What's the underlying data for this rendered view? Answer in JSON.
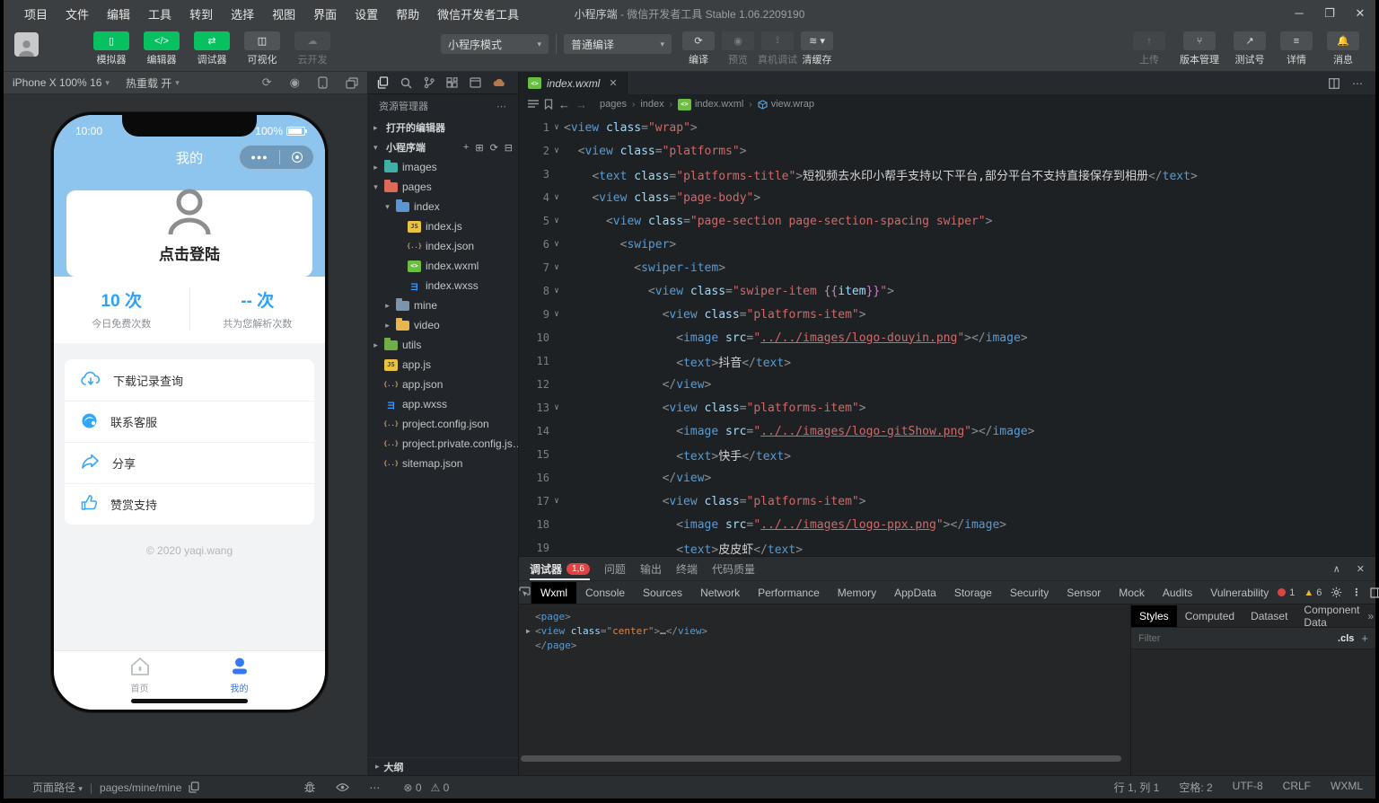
{
  "colors": {
    "accent_green": "#07c160",
    "phone_header_blue": "#8ec5ef",
    "app_blue": "#2aa2f8",
    "tab_active_blue": "#3478f6",
    "badge_red": "#e04343",
    "warn_yellow": "#e8b930"
  },
  "window": {
    "menus": [
      "项目",
      "文件",
      "编辑",
      "工具",
      "转到",
      "选择",
      "视图",
      "界面",
      "设置",
      "帮助",
      "微信开发者工具"
    ],
    "title_app": "小程序端",
    "title_rest": " - 微信开发者工具 Stable 1.06.2209190",
    "controls": {
      "minimize": "─",
      "maximize": "❐",
      "close": "✕"
    }
  },
  "toolbar": {
    "left_buttons": [
      {
        "name": "simulator-toggle",
        "label": "模拟器",
        "icon": "phone-icon",
        "state": "on"
      },
      {
        "name": "editor-toggle",
        "label": "编辑器",
        "icon": "code-icon",
        "state": "on"
      },
      {
        "name": "debugger-toggle",
        "label": "调试器",
        "icon": "swap-icon",
        "state": "on"
      },
      {
        "name": "visualizer-toggle",
        "label": "可视化",
        "icon": "layout-icon",
        "state": "off"
      },
      {
        "name": "cloud-dev",
        "label": "云开发",
        "icon": "cloud-icon",
        "state": "disabled"
      }
    ],
    "mode_select": "小程序模式",
    "compile_select": "普通编译",
    "action_buttons": [
      {
        "name": "compile-button",
        "label": "编译",
        "icon": "refresh-icon",
        "enabled": true
      },
      {
        "name": "preview-button",
        "label": "预览",
        "icon": "eye-icon",
        "enabled": false
      },
      {
        "name": "device-debug-button",
        "label": "真机调试",
        "icon": "bug-icon",
        "enabled": false
      },
      {
        "name": "clear-cache-button",
        "label": "清缓存",
        "icon": "layers-icon",
        "enabled": true,
        "caret": true
      }
    ],
    "right_buttons": [
      {
        "name": "upload-button",
        "label": "上传",
        "icon": "upload-icon",
        "enabled": false
      },
      {
        "name": "version-manage-button",
        "label": "版本管理",
        "icon": "branch-icon",
        "enabled": true
      },
      {
        "name": "test-account-button",
        "label": "测试号",
        "icon": "external-link-icon",
        "enabled": true
      },
      {
        "name": "details-button",
        "label": "详情",
        "icon": "list-icon",
        "enabled": true
      },
      {
        "name": "messages-button",
        "label": "消息",
        "icon": "bell-icon",
        "enabled": true
      }
    ]
  },
  "simulator": {
    "device": "iPhone X 100% 16",
    "hot_reload": "热重载 开",
    "icons": [
      "rotate-icon",
      "record-icon",
      "phone-frame-icon",
      "multi-window-icon"
    ]
  },
  "phone": {
    "time": "10:00",
    "battery": "100%",
    "nav_title": "我的",
    "login_label": "点击登陆",
    "stats": [
      {
        "value": "10 次",
        "label": "今日免费次数"
      },
      {
        "value": "-- 次",
        "label": "共为您解析次数"
      }
    ],
    "menu": [
      {
        "name": "download-history",
        "label": "下载记录查询",
        "icon": "cloud-download-icon"
      },
      {
        "name": "contact-support",
        "label": "联系客服",
        "icon": "customer-service-icon"
      },
      {
        "name": "share",
        "label": "分享",
        "icon": "share-icon"
      },
      {
        "name": "donate",
        "label": "赞赏支持",
        "icon": "thumb-up-icon"
      }
    ],
    "footer": "© 2020 yaqi.wang",
    "tabs": [
      {
        "label": "首页",
        "icon": "home-icon",
        "active": false
      },
      {
        "label": "我的",
        "icon": "person-icon",
        "active": true
      }
    ]
  },
  "explorer": {
    "title": "资源管理器",
    "more": "⋯",
    "sections": {
      "open_editors": "打开的编辑器",
      "project": "小程序端"
    },
    "section_actions": [
      "new-file-icon",
      "new-folder-icon",
      "refresh-icon",
      "collapse-all-icon"
    ],
    "tree": [
      {
        "lvl": 1,
        "arrow": "right",
        "icon": "images",
        "name": "images"
      },
      {
        "lvl": 1,
        "arrow": "down",
        "icon": "folder-red",
        "name": "pages"
      },
      {
        "lvl": 2,
        "arrow": "down",
        "icon": "folder-open-blue",
        "name": "index"
      },
      {
        "lvl": 3,
        "arrow": "",
        "icon": "js",
        "name": "index.js"
      },
      {
        "lvl": 3,
        "arrow": "",
        "icon": "json",
        "name": "index.json"
      },
      {
        "lvl": 3,
        "arrow": "",
        "icon": "wxml",
        "name": "index.wxml"
      },
      {
        "lvl": 3,
        "arrow": "",
        "icon": "wxss",
        "name": "index.wxss"
      },
      {
        "lvl": 2,
        "arrow": "right",
        "icon": "folder-slate",
        "name": "mine"
      },
      {
        "lvl": 2,
        "arrow": "right",
        "icon": "folder-yellow",
        "name": "video"
      },
      {
        "lvl": 1,
        "arrow": "right",
        "icon": "folder-green",
        "name": "utils"
      },
      {
        "lvl": 1,
        "arrow": "",
        "icon": "js",
        "name": "app.js"
      },
      {
        "lvl": 1,
        "arrow": "",
        "icon": "json",
        "name": "app.json"
      },
      {
        "lvl": 1,
        "arrow": "",
        "icon": "wxss",
        "name": "app.wxss"
      },
      {
        "lvl": 1,
        "arrow": "",
        "icon": "json",
        "name": "project.config.json"
      },
      {
        "lvl": 1,
        "arrow": "",
        "icon": "json",
        "name": "project.private.config.js…"
      },
      {
        "lvl": 1,
        "arrow": "",
        "icon": "json",
        "name": "sitemap.json"
      }
    ],
    "outline": "大纲",
    "problems": {
      "errors": "0",
      "warnings": "0"
    }
  },
  "editor": {
    "tab": "index.wxml",
    "breadcrumb": [
      "pages",
      "index",
      "index.wxml",
      "view.wrap"
    ],
    "code_lines": [
      {
        "fold": true,
        "ind": 0,
        "tk": [
          [
            "g",
            "<"
          ],
          [
            "t",
            "view"
          ],
          [
            "w",
            " "
          ],
          [
            "a",
            "class"
          ],
          [
            "g",
            "="
          ],
          [
            "s",
            "\"wrap\""
          ],
          [
            "g",
            ">"
          ]
        ]
      },
      {
        "fold": true,
        "ind": 2,
        "tk": [
          [
            "g",
            "<"
          ],
          [
            "t",
            "view"
          ],
          [
            "w",
            " "
          ],
          [
            "a",
            "class"
          ],
          [
            "g",
            "="
          ],
          [
            "s",
            "\"platforms\""
          ],
          [
            "g",
            ">"
          ]
        ]
      },
      {
        "fold": false,
        "ind": 4,
        "tk": [
          [
            "g",
            "<"
          ],
          [
            "t",
            "text"
          ],
          [
            "w",
            " "
          ],
          [
            "a",
            "class"
          ],
          [
            "g",
            "="
          ],
          [
            "s",
            "\"platforms-title\""
          ],
          [
            "g",
            ">"
          ],
          [
            "x",
            "短视频去水印小帮手支持以下平台,部分平台不支持直接保存到相册"
          ],
          [
            "g",
            "</"
          ],
          [
            "t",
            "text"
          ],
          [
            "g",
            ">"
          ]
        ]
      },
      {
        "fold": true,
        "ind": 4,
        "tk": [
          [
            "g",
            "<"
          ],
          [
            "t",
            "view"
          ],
          [
            "w",
            " "
          ],
          [
            "a",
            "class"
          ],
          [
            "g",
            "="
          ],
          [
            "s",
            "\"page-body\""
          ],
          [
            "g",
            ">"
          ]
        ]
      },
      {
        "fold": true,
        "ind": 6,
        "tk": [
          [
            "g",
            "<"
          ],
          [
            "t",
            "view"
          ],
          [
            "w",
            " "
          ],
          [
            "a",
            "class"
          ],
          [
            "g",
            "="
          ],
          [
            "s",
            "\"page-section page-section-spacing swiper\""
          ],
          [
            "g",
            ">"
          ]
        ]
      },
      {
        "fold": true,
        "ind": 8,
        "tk": [
          [
            "g",
            "<"
          ],
          [
            "t",
            "swiper"
          ],
          [
            "g",
            ">"
          ]
        ]
      },
      {
        "fold": true,
        "ind": 10,
        "tk": [
          [
            "g",
            "<"
          ],
          [
            "t",
            "swiper-item"
          ],
          [
            "g",
            ">"
          ]
        ]
      },
      {
        "fold": true,
        "ind": 12,
        "tk": [
          [
            "g",
            "<"
          ],
          [
            "t",
            "view"
          ],
          [
            "w",
            " "
          ],
          [
            "a",
            "class"
          ],
          [
            "g",
            "="
          ],
          [
            "s",
            "\"swiper-item "
          ],
          [
            "m",
            "{{"
          ],
          [
            "i",
            "item"
          ],
          [
            "m",
            "}}"
          ],
          [
            "s",
            "\""
          ],
          [
            "g",
            ">"
          ]
        ]
      },
      {
        "fold": true,
        "ind": 14,
        "tk": [
          [
            "g",
            "<"
          ],
          [
            "t",
            "view"
          ],
          [
            "w",
            " "
          ],
          [
            "a",
            "class"
          ],
          [
            "g",
            "="
          ],
          [
            "s",
            "\"platforms-item\""
          ],
          [
            "g",
            ">"
          ]
        ]
      },
      {
        "fold": false,
        "ind": 16,
        "tk": [
          [
            "g",
            "<"
          ],
          [
            "t",
            "image"
          ],
          [
            "w",
            " "
          ],
          [
            "a",
            "src"
          ],
          [
            "g",
            "="
          ],
          [
            "s",
            "\""
          ],
          [
            "l",
            "../../images/logo-douyin.png"
          ],
          [
            "s",
            "\""
          ],
          [
            "g",
            ">"
          ],
          [
            "g",
            "</"
          ],
          [
            "t",
            "image"
          ],
          [
            "g",
            ">"
          ]
        ]
      },
      {
        "fold": false,
        "ind": 16,
        "tk": [
          [
            "g",
            "<"
          ],
          [
            "t",
            "text"
          ],
          [
            "g",
            ">"
          ],
          [
            "x",
            "抖音"
          ],
          [
            "g",
            "</"
          ],
          [
            "t",
            "text"
          ],
          [
            "g",
            ">"
          ]
        ]
      },
      {
        "fold": false,
        "ind": 14,
        "tk": [
          [
            "g",
            "</"
          ],
          [
            "t",
            "view"
          ],
          [
            "g",
            ">"
          ]
        ]
      },
      {
        "fold": true,
        "ind": 14,
        "tk": [
          [
            "g",
            "<"
          ],
          [
            "t",
            "view"
          ],
          [
            "w",
            " "
          ],
          [
            "a",
            "class"
          ],
          [
            "g",
            "="
          ],
          [
            "s",
            "\"platforms-item\""
          ],
          [
            "g",
            ">"
          ]
        ]
      },
      {
        "fold": false,
        "ind": 16,
        "tk": [
          [
            "g",
            "<"
          ],
          [
            "t",
            "image"
          ],
          [
            "w",
            " "
          ],
          [
            "a",
            "src"
          ],
          [
            "g",
            "="
          ],
          [
            "s",
            "\""
          ],
          [
            "l",
            "../../images/logo-gitShow.png"
          ],
          [
            "s",
            "\""
          ],
          [
            "g",
            ">"
          ],
          [
            "g",
            "</"
          ],
          [
            "t",
            "image"
          ],
          [
            "g",
            ">"
          ]
        ]
      },
      {
        "fold": false,
        "ind": 16,
        "tk": [
          [
            "g",
            "<"
          ],
          [
            "t",
            "text"
          ],
          [
            "g",
            ">"
          ],
          [
            "x",
            "快手"
          ],
          [
            "g",
            "</"
          ],
          [
            "t",
            "text"
          ],
          [
            "g",
            ">"
          ]
        ]
      },
      {
        "fold": false,
        "ind": 14,
        "tk": [
          [
            "g",
            "</"
          ],
          [
            "t",
            "view"
          ],
          [
            "g",
            ">"
          ]
        ]
      },
      {
        "fold": true,
        "ind": 14,
        "tk": [
          [
            "g",
            "<"
          ],
          [
            "t",
            "view"
          ],
          [
            "w",
            " "
          ],
          [
            "a",
            "class"
          ],
          [
            "g",
            "="
          ],
          [
            "s",
            "\"platforms-item\""
          ],
          [
            "g",
            ">"
          ]
        ]
      },
      {
        "fold": false,
        "ind": 16,
        "tk": [
          [
            "g",
            "<"
          ],
          [
            "t",
            "image"
          ],
          [
            "w",
            " "
          ],
          [
            "a",
            "src"
          ],
          [
            "g",
            "="
          ],
          [
            "s",
            "\""
          ],
          [
            "l",
            "../../images/logo-ppx.png"
          ],
          [
            "s",
            "\""
          ],
          [
            "g",
            ">"
          ],
          [
            "g",
            "</"
          ],
          [
            "t",
            "image"
          ],
          [
            "g",
            ">"
          ]
        ]
      },
      {
        "fold": false,
        "ind": 16,
        "tk": [
          [
            "g",
            "<"
          ],
          [
            "t",
            "text"
          ],
          [
            "g",
            ">"
          ],
          [
            "x",
            "皮皮虾"
          ],
          [
            "g",
            "</"
          ],
          [
            "t",
            "text"
          ],
          [
            "g",
            ">"
          ]
        ]
      }
    ]
  },
  "debugger": {
    "title": "调试器",
    "badge": "1,6",
    "panel_tabs": [
      "问题",
      "输出",
      "终端",
      "代码质量"
    ],
    "window_controls": {
      "collapse": "∧",
      "close": "✕"
    },
    "devtools_tabs": [
      "Wxml",
      "Console",
      "Sources",
      "Network",
      "Performance",
      "Memory",
      "AppData",
      "Storage",
      "Security",
      "Sensor",
      "Mock",
      "Audits",
      "Vulnerability"
    ],
    "active_tab": "Wxml",
    "error_count": "1",
    "warning_count": "6",
    "wxml_tree": [
      {
        "arrow": "",
        "tk": [
          [
            "g",
            "<"
          ],
          [
            "t",
            "page"
          ],
          [
            "g",
            ">"
          ]
        ]
      },
      {
        "arrow": "right",
        "tk": [
          [
            "g",
            "<"
          ],
          [
            "t",
            "view"
          ],
          [
            "w",
            " "
          ],
          [
            "a",
            "class"
          ],
          [
            "g",
            "=\""
          ],
          [
            "o",
            "center"
          ],
          [
            "g",
            "\">"
          ],
          [
            "x",
            "…"
          ],
          [
            "g",
            "</"
          ],
          [
            "t",
            "view"
          ],
          [
            "g",
            ">"
          ]
        ]
      },
      {
        "arrow": "",
        "tk": [
          [
            "g",
            "</"
          ],
          [
            "t",
            "page"
          ],
          [
            "g",
            ">"
          ]
        ]
      }
    ],
    "styles_tabs": [
      "Styles",
      "Computed",
      "Dataset",
      "Component Data"
    ],
    "styles_active": "Styles",
    "styles_more": "»",
    "filter_placeholder": "Filter",
    "cls_label": ".cls",
    "add_label": "+"
  },
  "statusbar": {
    "page_path_label": "页面路径",
    "page_path": "pages/mine/mine",
    "errors": "0",
    "warnings": "0",
    "line_col": "行 1, 列 1",
    "spaces": "空格: 2",
    "encoding": "UTF-8",
    "eol": "CRLF",
    "lang": "WXML"
  }
}
